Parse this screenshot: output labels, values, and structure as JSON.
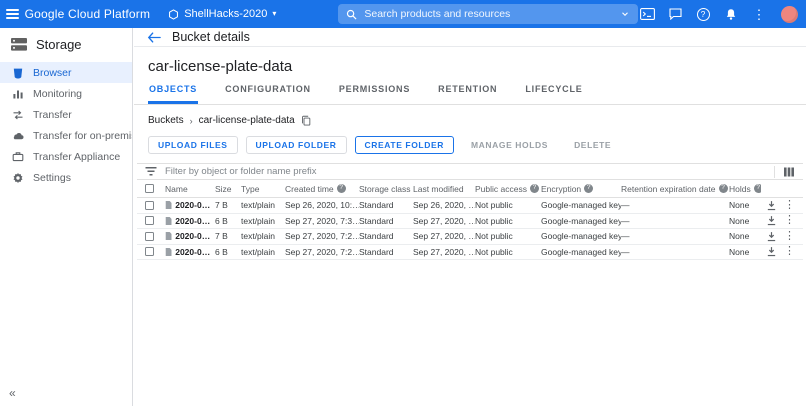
{
  "topbar": {
    "product": "Google Cloud Platform",
    "project": "ShellHacks-2020",
    "search_placeholder": "Search products and resources"
  },
  "sidebar": {
    "title": "Storage",
    "items": [
      {
        "label": "Browser"
      },
      {
        "label": "Monitoring"
      },
      {
        "label": "Transfer"
      },
      {
        "label": "Transfer for on-premises"
      },
      {
        "label": "Transfer Appliance"
      },
      {
        "label": "Settings"
      }
    ]
  },
  "page": {
    "header": "Bucket details",
    "bucket_name": "car-license-plate-data",
    "tabs": [
      {
        "label": "OBJECTS"
      },
      {
        "label": "CONFIGURATION"
      },
      {
        "label": "PERMISSIONS"
      },
      {
        "label": "RETENTION"
      },
      {
        "label": "LIFECYCLE"
      }
    ],
    "breadcrumb": {
      "root": "Buckets",
      "current": "car-license-plate-data"
    },
    "actions": {
      "upload_files": "UPLOAD FILES",
      "upload_folder": "UPLOAD FOLDER",
      "create_folder": "CREATE FOLDER",
      "manage_holds": "MANAGE HOLDS",
      "delete": "DELETE"
    },
    "filter_placeholder": "Filter by object or folder name prefix"
  },
  "table": {
    "columns": {
      "name": "Name",
      "size": "Size",
      "type": "Type",
      "created": "Created time",
      "storage_class": "Storage class",
      "modified": "Last modified",
      "public_access": "Public access",
      "encryption": "Encryption",
      "retention": "Retention expiration date",
      "holds": "Holds"
    },
    "rows": [
      {
        "name": "2020-09…",
        "size": "7 B",
        "type": "text/plain",
        "created": "Sep 26, 2020, 10:…",
        "storage_class": "Standard",
        "modified": "Sep 26, 2020, …",
        "public_access": "Not public",
        "encryption": "Google-managed key",
        "retention": "—",
        "holds": "None"
      },
      {
        "name": "2020-09…",
        "size": "6 B",
        "type": "text/plain",
        "created": "Sep 27, 2020, 7:3…",
        "storage_class": "Standard",
        "modified": "Sep 27, 2020, …",
        "public_access": "Not public",
        "encryption": "Google-managed key",
        "retention": "—",
        "holds": "None"
      },
      {
        "name": "2020-09…",
        "size": "7 B",
        "type": "text/plain",
        "created": "Sep 27, 2020, 7:2…",
        "storage_class": "Standard",
        "modified": "Sep 27, 2020, …",
        "public_access": "Not public",
        "encryption": "Google-managed key",
        "retention": "—",
        "holds": "None"
      },
      {
        "name": "2020-09…",
        "size": "6 B",
        "type": "text/plain",
        "created": "Sep 27, 2020, 7:2…",
        "storage_class": "Standard",
        "modified": "Sep 27, 2020, …",
        "public_access": "Not public",
        "encryption": "Google-managed key",
        "retention": "—",
        "holds": "None"
      }
    ]
  },
  "glyphs": {
    "help": "?",
    "more": "⋮",
    "collapse": "«",
    "breadcrumb_separator": "›",
    "project_caret": "▾"
  },
  "colors": {
    "topbar": "#1a73e8",
    "accent": "#1a73e8",
    "selected_item_bg": "#e8f0fe",
    "selected_item_text": "#1967d2",
    "avatar": "#ef867f"
  }
}
